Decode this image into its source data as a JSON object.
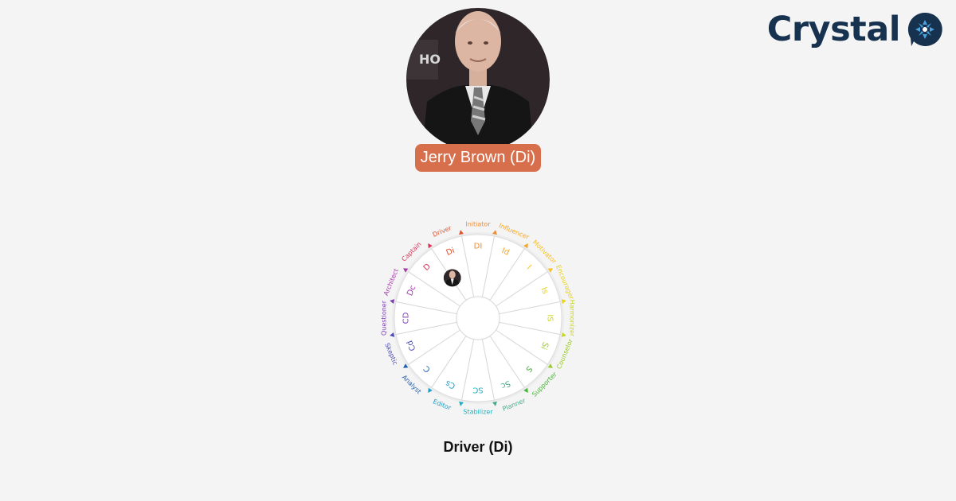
{
  "brand": {
    "name": "Crystal",
    "icon": "crystal-logo-icon",
    "colors": {
      "text": "#16324f",
      "icon_bg": "#16324f",
      "icon_fg": "#4aa3df"
    }
  },
  "profile": {
    "name_label": "Jerry Brown (Di)",
    "photo_icon": "person-photo",
    "pill_color": "#d86f4c"
  },
  "disc_wheel": {
    "highlighted": "Di",
    "segments": [
      {
        "code": "DI",
        "name": "Initiator",
        "color": "#ef8d32"
      },
      {
        "code": "Id",
        "name": "Influencer",
        "color": "#f5a623"
      },
      {
        "code": "I",
        "name": "Motivator",
        "color": "#f7bf1f"
      },
      {
        "code": "Is",
        "name": "Encourager",
        "color": "#e8d21a"
      },
      {
        "code": "IS",
        "name": "Harmonizer",
        "color": "#c9d61e"
      },
      {
        "code": "Si",
        "name": "Counselor",
        "color": "#9ac92a"
      },
      {
        "code": "S",
        "name": "Supporter",
        "color": "#44b535"
      },
      {
        "code": "Sc",
        "name": "Planner",
        "color": "#4aa98a"
      },
      {
        "code": "SC",
        "name": "Stabilizer",
        "color": "#1fb1c1"
      },
      {
        "code": "Cs",
        "name": "Editor",
        "color": "#1a9ec9"
      },
      {
        "code": "C",
        "name": "Analyst",
        "color": "#1f5fb0"
      },
      {
        "code": "Cd",
        "name": "Skeptic",
        "color": "#4a4ab8"
      },
      {
        "code": "CD",
        "name": "Questioner",
        "color": "#7b3fb4"
      },
      {
        "code": "Dc",
        "name": "Architect",
        "color": "#a43aa8"
      },
      {
        "code": "D",
        "name": "Captain",
        "color": "#d8345a"
      },
      {
        "code": "Di",
        "name": "Driver",
        "color": "#e5512e"
      }
    ]
  },
  "type_title": "Driver (Di)"
}
